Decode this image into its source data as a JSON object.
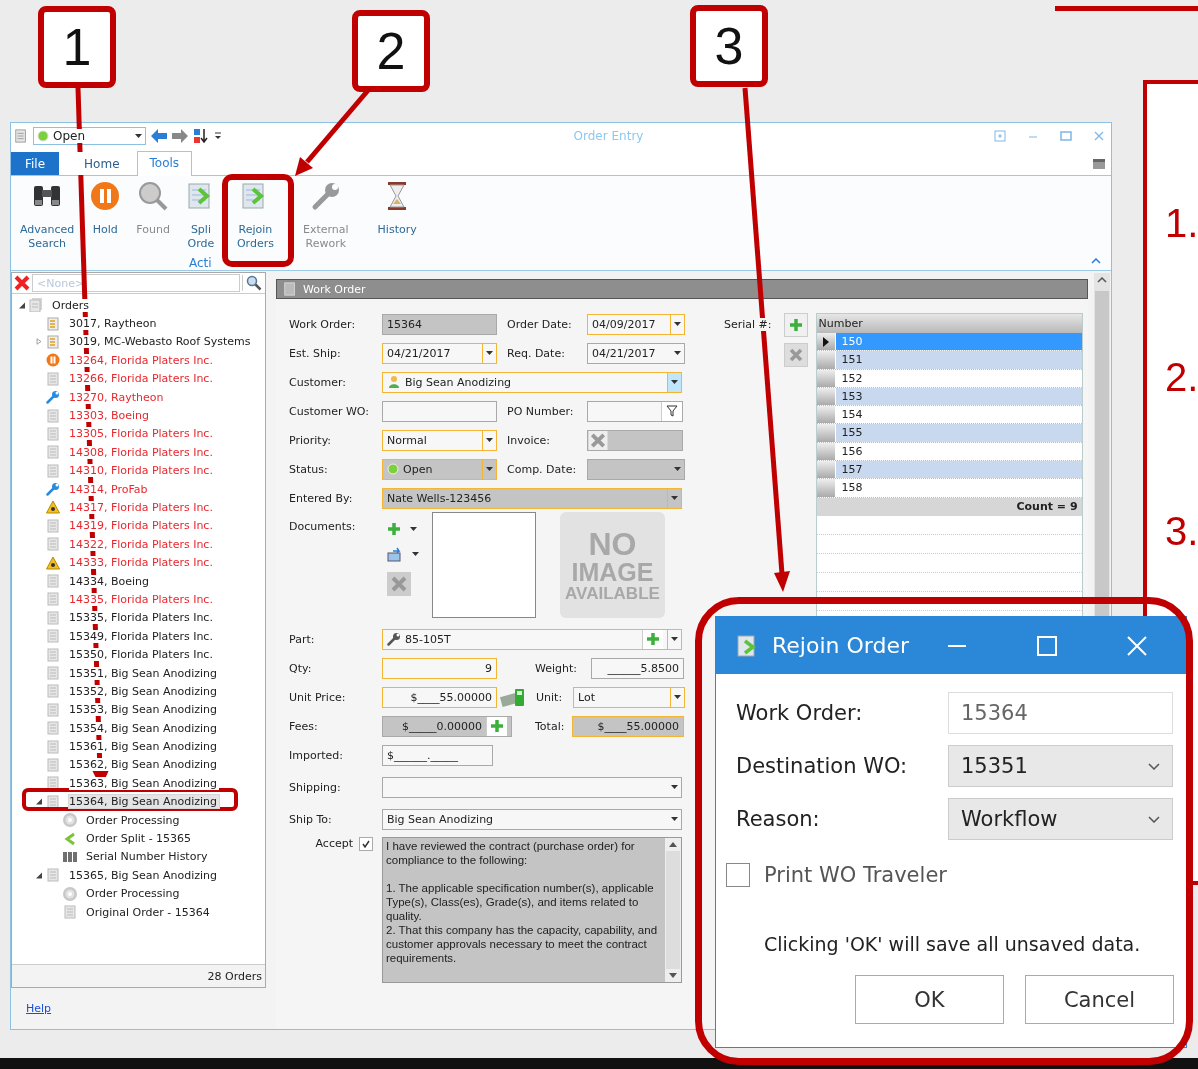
{
  "window": {
    "title": "Order Entry",
    "status_combo": "Open"
  },
  "ribbon": {
    "tabs": [
      {
        "label": "File",
        "kind": "menu",
        "selected": false
      },
      {
        "label": "Home",
        "kind": "tab",
        "selected": false
      },
      {
        "label": "Tools",
        "kind": "tab",
        "selected": true
      }
    ],
    "buttons": [
      {
        "kind": "advanced_search",
        "lines": [
          "Advanced",
          "Search"
        ],
        "disabled": false
      },
      {
        "kind": "hold",
        "lines": [
          "Hold"
        ],
        "disabled": false
      },
      {
        "kind": "found",
        "lines": [
          "Found"
        ],
        "disabled": true
      },
      {
        "kind": "split",
        "lines": [
          "Spli",
          "Orde"
        ],
        "disabled": false
      },
      {
        "kind": "rejoin",
        "lines": [
          "Rejoin",
          "Orders"
        ],
        "disabled": false
      },
      {
        "kind": "external_rework",
        "lines": [
          "External",
          "Rework"
        ],
        "disabled": true
      },
      {
        "kind": "history",
        "lines": [
          "History"
        ],
        "disabled": false
      }
    ],
    "group_label": "Acti"
  },
  "tree": {
    "filter_placeholder": "<None>",
    "footer": "28 Orders",
    "items": [
      {
        "label": "Orders",
        "kind": "folder",
        "expanded": true,
        "selected": false,
        "late": false,
        "children": [
          {
            "label": "3017, Raytheon",
            "kind": "traveler",
            "selected": false,
            "late": false
          },
          {
            "label": "3019, MC-Webasto Roof Systems",
            "kind": "traveler",
            "expanded": false,
            "selected": false,
            "late": false
          },
          {
            "label": "13264, Florida Platers Inc.",
            "kind": "on_hold",
            "selected": false,
            "late": true
          },
          {
            "label": "13266, Florida Platers Inc.",
            "kind": "order",
            "selected": false,
            "late": true
          },
          {
            "label": "13270, Raytheon",
            "kind": "rework",
            "selected": false,
            "late": true
          },
          {
            "label": "13303, Boeing",
            "kind": "order",
            "selected": false,
            "late": true
          },
          {
            "label": "13305, Florida Platers Inc.",
            "kind": "order",
            "selected": false,
            "late": true
          },
          {
            "label": "14308, Florida Platers Inc.",
            "kind": "order",
            "selected": false,
            "late": true
          },
          {
            "label": "14310, Florida Platers Inc.",
            "kind": "order",
            "selected": false,
            "late": true
          },
          {
            "label": "14314, ProFab",
            "kind": "rework",
            "selected": false,
            "late": true
          },
          {
            "label": "14317, Florida Platers Inc.",
            "kind": "hazard",
            "selected": false,
            "late": true
          },
          {
            "label": "14319, Florida Platers Inc.",
            "kind": "order",
            "selected": false,
            "late": true
          },
          {
            "label": "14322, Florida Platers Inc.",
            "kind": "order",
            "selected": false,
            "late": true
          },
          {
            "label": "14333, Florida Platers Inc.",
            "kind": "hazard",
            "selected": false,
            "late": true
          },
          {
            "label": "14334, Boeing",
            "kind": "order",
            "selected": false,
            "late": false
          },
          {
            "label": "14335, Florida Platers Inc.",
            "kind": "order",
            "selected": false,
            "late": true
          },
          {
            "label": "15335, Florida Platers Inc.",
            "kind": "order",
            "selected": false,
            "late": false
          },
          {
            "label": "15349, Florida Platers Inc.",
            "kind": "order",
            "selected": false,
            "late": false
          },
          {
            "label": "15350, Florida Platers Inc.",
            "kind": "order",
            "selected": false,
            "late": false
          },
          {
            "label": "15351, Big Sean Anodizing",
            "kind": "order",
            "selected": false,
            "late": false
          },
          {
            "label": "15352, Big Sean Anodizing",
            "kind": "order",
            "selected": false,
            "late": false
          },
          {
            "label": "15353, Big Sean Anodizing",
            "kind": "order",
            "selected": false,
            "late": false
          },
          {
            "label": "15354, Big Sean Anodizing",
            "kind": "order",
            "selected": false,
            "late": false
          },
          {
            "label": "15361, Big Sean Anodizing",
            "kind": "order",
            "selected": false,
            "late": false
          },
          {
            "label": "15362, Big Sean Anodizing",
            "kind": "order",
            "selected": false,
            "late": false
          },
          {
            "label": "15363, Big Sean Anodizing",
            "kind": "order",
            "selected": false,
            "late": false
          },
          {
            "label": "15364, Big Sean Anodizing",
            "kind": "order",
            "expanded": true,
            "selected": true,
            "late": false,
            "children": [
              {
                "label": "Order Processing",
                "kind": "processing",
                "selected": false,
                "late": false
              },
              {
                "label": "Order Split - 15365",
                "kind": "split",
                "selected": false,
                "late": false
              },
              {
                "label": "Serial Number History",
                "kind": "serial_history",
                "selected": false,
                "late": false
              }
            ]
          },
          {
            "label": "15365, Big Sean Anodizing",
            "kind": "order",
            "expanded": true,
            "selected": false,
            "late": false,
            "children": [
              {
                "label": "Order Processing",
                "kind": "processing",
                "selected": false,
                "late": false
              },
              {
                "label": "Original Order - 15364",
                "kind": "order",
                "selected": false,
                "late": false
              }
            ]
          }
        ]
      }
    ]
  },
  "help_link": "Help",
  "panel_title": "Work Order",
  "form": {
    "work_order": {
      "label": "Work Order:",
      "value": "15364",
      "required": false,
      "readonly": true
    },
    "order_date": {
      "label": "Order Date:",
      "value": "04/09/2017",
      "required": true,
      "readonly": false
    },
    "est_ship": {
      "label": "Est. Ship:",
      "value": "04/21/2017",
      "required": true,
      "readonly": false
    },
    "req_date": {
      "label": "Req. Date:",
      "value": "04/21/2017",
      "required": false,
      "readonly": false
    },
    "customer": {
      "label": "Customer:",
      "value": "Big Sean Anodizing",
      "required": true,
      "readonly": false
    },
    "customer_wo": {
      "label": "Customer WO:",
      "required": false,
      "readonly": false
    },
    "po_number": {
      "label": "PO Number:",
      "required": false,
      "readonly": false
    },
    "priority": {
      "label": "Priority:",
      "value": "Normal",
      "required": true,
      "readonly": false
    },
    "invoice": {
      "label": "Invoice:",
      "required": false,
      "readonly": true
    },
    "status": {
      "label": "Status:",
      "value": "Open",
      "required": true,
      "readonly": true
    },
    "comp_date": {
      "label": "Comp. Date:",
      "required": false,
      "readonly": true
    },
    "entered_by": {
      "label": "Entered By:",
      "value": "Nate Wells-123456",
      "required": true,
      "readonly": true
    },
    "part": {
      "label": "Part:",
      "value": "85-105T",
      "required": true,
      "readonly": false
    },
    "qty": {
      "label": "Qty:",
      "value": "9",
      "required": true,
      "readonly": false
    },
    "weight": {
      "label": "Weight:",
      "value": "______5.8500",
      "required": false,
      "readonly": false
    },
    "unit_price": {
      "label": "Unit Price:",
      "value": "$____55.00000",
      "required": true,
      "readonly": false
    },
    "unit": {
      "label": "Unit:",
      "value": "Lot",
      "required": true,
      "readonly": false
    },
    "fees": {
      "label": "Fees:",
      "value": "$_____0.00000",
      "required": false,
      "readonly": true
    },
    "total": {
      "label": "Total:",
      "value": "$____55.00000",
      "required": true,
      "readonly": true
    },
    "imported": {
      "label": "Imported:",
      "value": "$______._____",
      "required": false,
      "readonly": false
    },
    "shipping": {
      "label": "Shipping:",
      "required": false,
      "readonly": false
    },
    "ship_to": {
      "label": "Ship To:",
      "value": "Big Sean Anodizing",
      "required": false,
      "readonly": false
    }
  },
  "documents": {
    "label": "Documents:",
    "no_image": [
      "NO",
      "IMAGE",
      "AVAILABLE"
    ]
  },
  "accept": {
    "label": "Accept",
    "checked": true,
    "terms": [
      "I have reviewed the contract (purchase order) for compliance to the following:",
      "1. The applicable specification number(s), applicable Type(s), Class(es), Grade(s), and items related to quality.",
      "2. That this company has the capacity, capability, and customer approvals necessary to meet the contract requirements."
    ]
  },
  "serials": {
    "label": "Serial #:",
    "header": "Number",
    "footer": "Count = 9",
    "rows": [
      {
        "value": "150",
        "selected": true
      },
      {
        "value": "151",
        "selected": false
      },
      {
        "value": "152",
        "selected": false
      },
      {
        "value": "153",
        "selected": false
      },
      {
        "value": "154",
        "selected": false
      },
      {
        "value": "155",
        "selected": false
      },
      {
        "value": "156",
        "selected": false
      },
      {
        "value": "157",
        "selected": false
      },
      {
        "value": "158",
        "selected": false
      }
    ]
  },
  "dialog": {
    "title": "Rejoin Order",
    "fields": [
      {
        "label": "Work Order:",
        "value": "15364",
        "kind": "text"
      },
      {
        "label": "Destination WO:",
        "value": "15351",
        "kind": "combo"
      },
      {
        "label": "Reason:",
        "value": "Workflow",
        "kind": "combo"
      }
    ],
    "print_traveler": {
      "label": "Print WO Traveler",
      "checked": false
    },
    "message": "Clicking 'OK' will save all unsaved data.",
    "buttons": [
      "OK",
      "Cancel"
    ]
  },
  "callouts": [
    {
      "number": "1"
    },
    {
      "number": "2"
    },
    {
      "number": "3"
    }
  ],
  "side_panel": {
    "items": [
      "1.",
      "2.",
      "3."
    ]
  }
}
